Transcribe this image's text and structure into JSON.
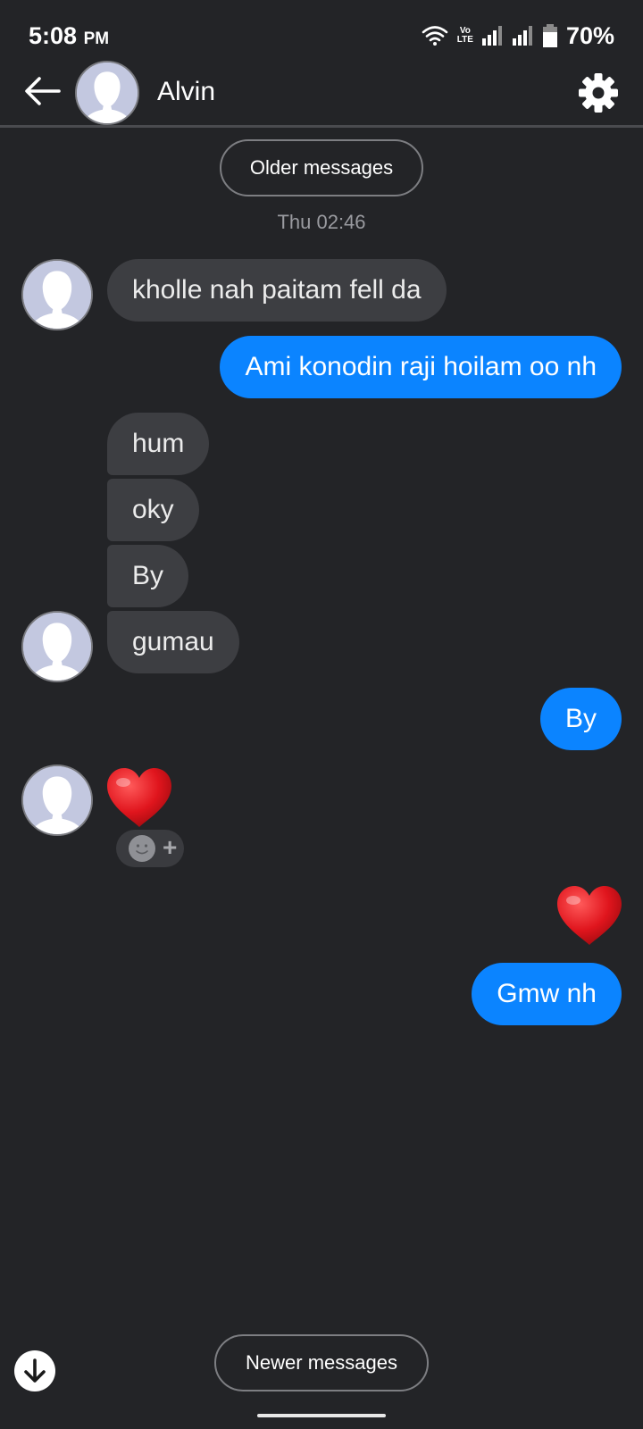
{
  "status_bar": {
    "time": "5:08",
    "ampm": "PM",
    "volte_line1": "Vo",
    "volte_line2": "LTE",
    "battery": "70%"
  },
  "header": {
    "contact_name": "Alvin"
  },
  "history": {
    "older_label": "Older messages",
    "newer_label": "Newer messages",
    "timestamp": "Thu 02:46"
  },
  "messages": [
    {
      "from": "them",
      "text": "kholle nah paitam fell da"
    },
    {
      "from": "me",
      "text": "Ami konodin raji hoilam oo nh"
    },
    {
      "from": "them",
      "text": "hum"
    },
    {
      "from": "them",
      "text": "oky"
    },
    {
      "from": "them",
      "text": "By"
    },
    {
      "from": "them",
      "text": "gumau"
    },
    {
      "from": "me",
      "text": "By"
    },
    {
      "from": "them",
      "text": "❤"
    },
    {
      "from": "me",
      "text": "❤"
    },
    {
      "from": "me",
      "text": "Gmw nh"
    }
  ],
  "reaction_add": "+",
  "colors": {
    "background": "#232427",
    "incoming_bubble": "#3d3e42",
    "outgoing_bubble": "#0b84ff",
    "heart": "#e0151d"
  }
}
